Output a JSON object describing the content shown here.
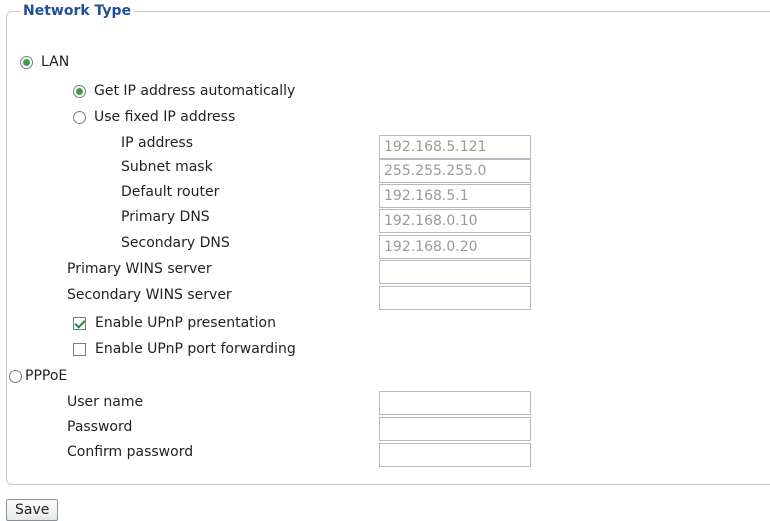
{
  "section": {
    "legend": "Network Type"
  },
  "lan": {
    "label": "LAN"
  },
  "ip_auto": {
    "label": "Get IP address automatically"
  },
  "ip_fixed": {
    "label": "Use fixed IP address"
  },
  "fields": {
    "ip_address": {
      "label": "IP address",
      "value": "192.168.5.121"
    },
    "subnet_mask": {
      "label": "Subnet mask",
      "value": "255.255.255.0"
    },
    "default_router": {
      "label": "Default router",
      "value": "192.168.5.1"
    },
    "primary_dns": {
      "label": "Primary DNS",
      "value": "192.168.0.10"
    },
    "secondary_dns": {
      "label": "Secondary DNS",
      "value": "192.168.0.20"
    },
    "primary_wins": {
      "label": "Primary WINS server",
      "value": ""
    },
    "secondary_wins": {
      "label": "Secondary WINS server",
      "value": ""
    }
  },
  "upnp": {
    "presentation": "Enable UPnP presentation",
    "port_forwarding": "Enable UPnP port forwarding"
  },
  "pppoe": {
    "label": "PPPoE",
    "user_name": {
      "label": "User name",
      "value": ""
    },
    "password": {
      "label": "Password",
      "value": ""
    },
    "confirm_password": {
      "label": "Confirm password",
      "value": ""
    }
  },
  "save": {
    "label": "Save"
  },
  "colors": {
    "legend": "#1f4f9b",
    "radio_dot": "#3aa33a",
    "check": "#2b8a2b"
  }
}
